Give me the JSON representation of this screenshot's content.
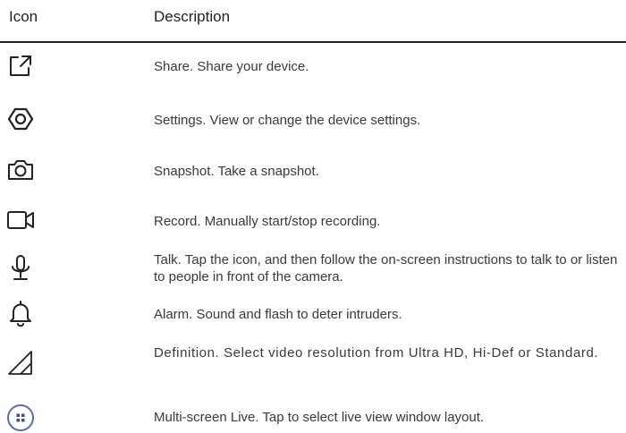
{
  "table": {
    "headers": {
      "icon": "Icon",
      "description": "Description"
    },
    "rows": [
      {
        "icon": "share-icon",
        "text": "Share. Share your device."
      },
      {
        "icon": "settings-icon",
        "text": "Settings. View or change the device settings."
      },
      {
        "icon": "camera-icon",
        "text": "Snapshot. Take a snapshot."
      },
      {
        "icon": "video-camera-icon",
        "text": "Record. Manually start/stop recording."
      },
      {
        "icon": "microphone-icon",
        "text": "Talk. Tap the icon, and then follow the on-screen instructions to talk to or listen to people in front of the camera."
      },
      {
        "icon": "bell-icon",
        "text": "Alarm. Sound and flash to deter intruders."
      },
      {
        "icon": "definition-icon",
        "text": "Definition. Select video resolution from Ultra HD, Hi-Def or Standard."
      },
      {
        "icon": "multi-screen-icon",
        "text": "Multi-screen Live. Tap to select live view window layout."
      }
    ]
  }
}
